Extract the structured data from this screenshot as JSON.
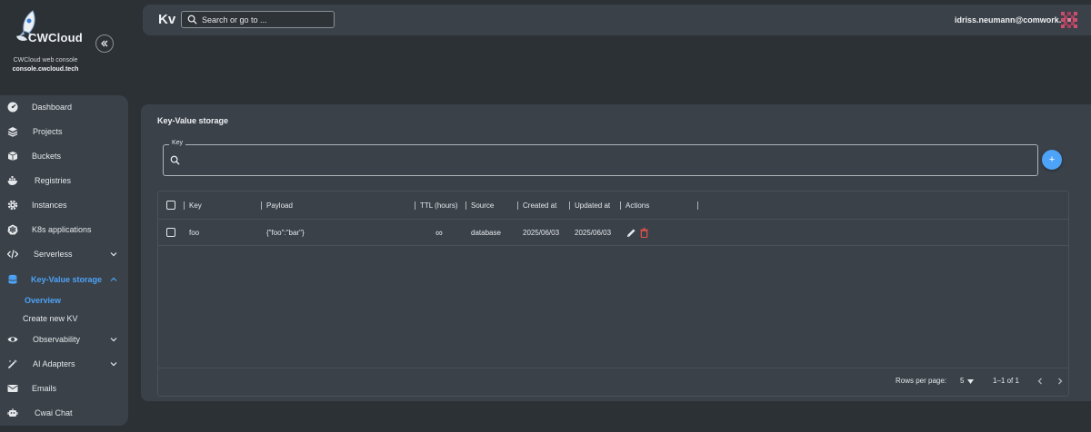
{
  "brand": {
    "logo_text": "CWCloud",
    "subtitle": "CWCloud web console",
    "url": "console.cwcloud.tech"
  },
  "header": {
    "title": "Kv",
    "search_placeholder": "Search or go to ...",
    "user_email": "idriss.neumann@comwork.io"
  },
  "sidebar": {
    "items": [
      {
        "label": "Dashboard",
        "icon": "dashboard-icon"
      },
      {
        "label": "Projects",
        "icon": "layers-icon"
      },
      {
        "label": "Buckets",
        "icon": "box-icon"
      },
      {
        "label": "Registries",
        "icon": "docker-icon"
      },
      {
        "label": "Instances",
        "icon": "settings-icon"
      },
      {
        "label": "K8s applications",
        "icon": "kubernetes-icon"
      },
      {
        "label": "Serverless",
        "icon": "code-icon"
      },
      {
        "label": "Key-Value storage",
        "icon": "database-icon"
      },
      {
        "label": "Observability",
        "icon": "eye-icon"
      },
      {
        "label": "AI Adapters",
        "icon": "magic-wand-icon"
      },
      {
        "label": "Emails",
        "icon": "mail-icon"
      },
      {
        "label": "Cwai Chat",
        "icon": "robot-icon"
      }
    ],
    "sub_items": [
      "Overview",
      "Create new KV"
    ],
    "active": "Key-Value storage"
  },
  "main": {
    "section_title": "Key-Value storage",
    "key_field_label": "Key",
    "key_field_value": "",
    "add_button": "+",
    "table": {
      "columns": [
        "Key",
        "Payload",
        "TTL (hours)",
        "Source",
        "Created at",
        "Updated at",
        "Actions"
      ],
      "rows": [
        {
          "key": "foo",
          "payload": "{\"foo\":\"bar\"}",
          "ttl": "∞",
          "source": "database",
          "created": "2025/06/03",
          "updated": "2025/06/03"
        }
      ]
    },
    "pagination": {
      "rows_per_page_label": "Rows per page:",
      "rows_per_page": "5",
      "range": "1–1 of 1"
    }
  },
  "colors": {
    "accent": "#4da3f7",
    "delete": "#e5534b",
    "background": "#2c3136",
    "panel": "#3a4149"
  }
}
